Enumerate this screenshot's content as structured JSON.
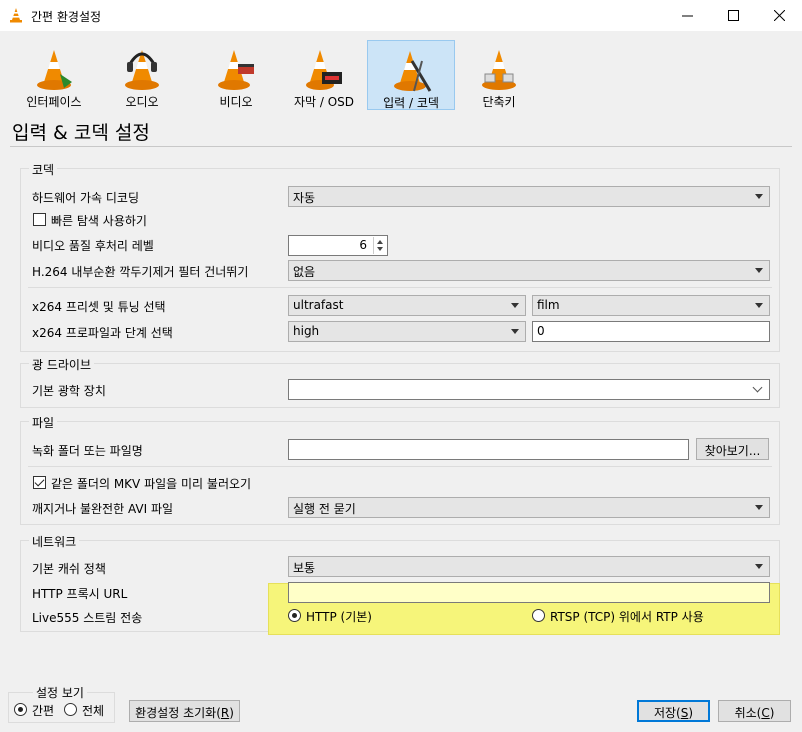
{
  "window": {
    "title": "간편 환경설정"
  },
  "categories": [
    {
      "label": "인터페이스",
      "icon": "interface-icon"
    },
    {
      "label": "오디오",
      "icon": "audio-icon"
    },
    {
      "label": "비디오",
      "icon": "video-icon"
    },
    {
      "label": "자막 / OSD",
      "icon": "subtitle-icon"
    },
    {
      "label": "입력 / 코덱",
      "icon": "input-codec-icon",
      "active": true
    },
    {
      "label": "단축키",
      "icon": "hotkeys-icon"
    }
  ],
  "page_title": "입력 & 코덱 설정",
  "codec": {
    "title": "코덱",
    "hw_decoding": {
      "label": "하드웨어 가속 디코딩",
      "value": "자동"
    },
    "fast_seek": {
      "label": "빠른 탐색 사용하기",
      "checked": false
    },
    "postproc": {
      "label": "비디오 품질 후처리 레벨",
      "value": "6"
    },
    "h264_skip": {
      "label": "H.264 내부순환 깍두기제거 필터 건너뛰기",
      "value": "없음"
    },
    "x264_preset": {
      "label": "x264 프리셋 및 튜닝 선택",
      "preset": "ultrafast",
      "tune": "film"
    },
    "x264_profile": {
      "label": "x264 프로파일과 단계 선택",
      "profile": "high",
      "level": "0"
    }
  },
  "optical": {
    "title": "광 드라이브",
    "device": {
      "label": "기본 광학 장치",
      "value": ""
    }
  },
  "file": {
    "title": "파일",
    "record": {
      "label": "녹화 폴더 또는 파일명",
      "value": "",
      "browse": "찾아보기..."
    },
    "mkv_preload": {
      "label": "같은 폴더의 MKV 파일을 미리 불러오기",
      "checked": true
    },
    "avi": {
      "label": "깨지거나 불완전한 AVI 파일",
      "value": "실행 전 묻기"
    }
  },
  "network": {
    "title": "네트워크",
    "cache": {
      "label": "기본 캐쉬 정책",
      "value": "보통"
    },
    "proxy": {
      "label": "HTTP 프록시 URL",
      "value": ""
    },
    "live555": {
      "label": "Live555 스트림 전송",
      "option_http": "HTTP (기본)",
      "option_rtsp": "RTSP (TCP) 위에서 RTP 사용",
      "selected": "http"
    }
  },
  "footer": {
    "show_title": "설정 보기",
    "simple": "간편",
    "all": "전체",
    "reset": "환경설정 초기화(",
    "reset_key": "R",
    "save": "저장(",
    "save_key": "S",
    "cancel": "취소(",
    "cancel_key": "C",
    "close_paren": ")"
  }
}
